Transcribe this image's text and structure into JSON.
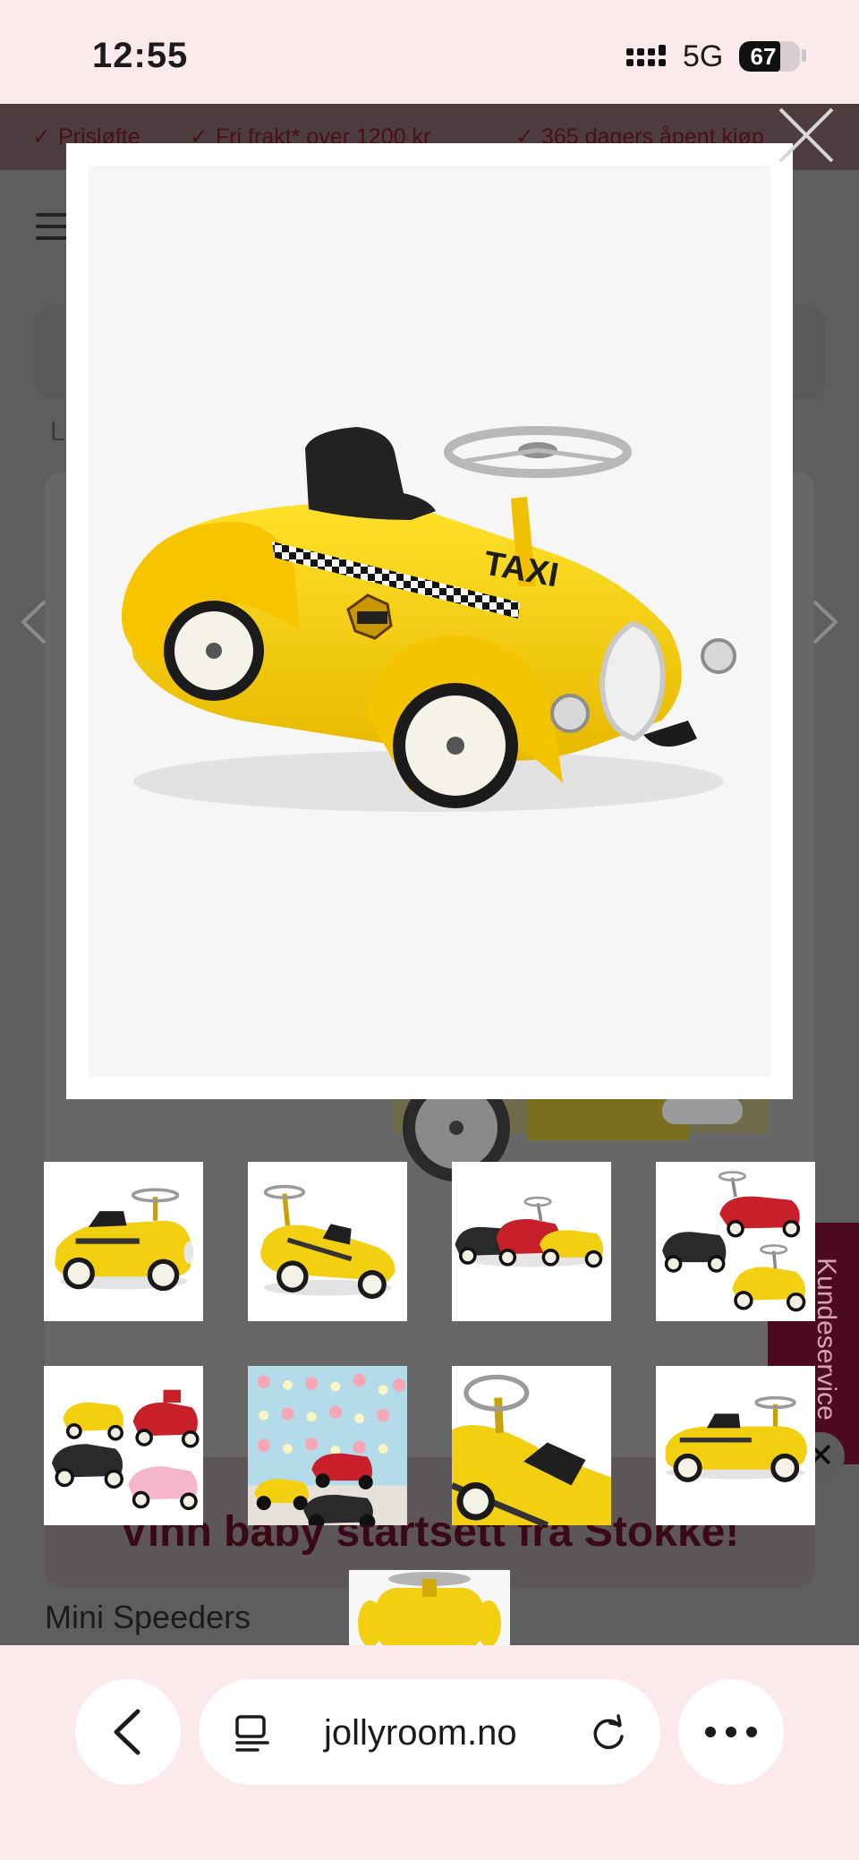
{
  "status_bar": {
    "time": "12:55",
    "network": "5G",
    "battery_percent": "67"
  },
  "usp_bar": {
    "items": [
      "Prisløfte",
      "Fri frakt* over 1200 kr",
      "365 dagers åpent kjøp"
    ]
  },
  "background_page": {
    "breadcrumb": "L",
    "product_brand": "Mini Speeders",
    "promo_text": "Vinn baby startsett fra Stokke!",
    "customer_service_tab": "Kundeservice",
    "customer_service_close": "✕"
  },
  "lightbox": {
    "main_image": "yellow-taxi-ride-on-car",
    "car_label": "TAXI",
    "thumbnails": [
      "taxi-car-side-front",
      "taxi-car-angle",
      "three-cars-black-red-yellow",
      "three-cars-group",
      "four-cars-group",
      "cars-on-pattern-wallpaper",
      "taxi-car-close-up-steering",
      "taxi-car-side-view"
    ]
  },
  "browser": {
    "url": "jollyroom.no"
  },
  "colors": {
    "chrome_bg": "#fce9ec",
    "overlay_bg": "#5e5e5e",
    "brand_dark": "#4c0a20",
    "taxi_yellow": "#f3cf12"
  }
}
